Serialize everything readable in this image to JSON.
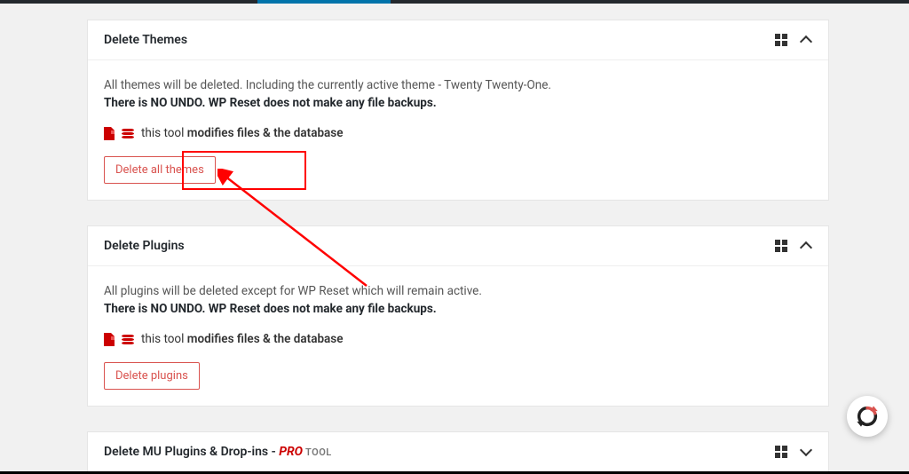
{
  "cards": {
    "themes": {
      "title": "Delete Themes",
      "desc": "All themes will be deleted. Including the currently active theme - Twenty Twenty-One.",
      "warn": "There is NO UNDO. WP Reset does not make any file backups.",
      "meta_prefix": "this tool ",
      "meta_bold": "modifies files & the database",
      "button": "Delete all themes"
    },
    "plugins": {
      "title": "Delete Plugins",
      "desc": "All plugins will be deleted except for WP Reset which will remain active.",
      "warn": "There is NO UNDO. WP Reset does not make any file backups.",
      "meta_prefix": "this tool ",
      "meta_bold": "modifies files & the database",
      "button": "Delete plugins"
    },
    "mu": {
      "title_prefix": "Delete MU Plugins & Drop-ins - ",
      "title_pro": "PRO",
      "title_tool": " TOOL"
    }
  }
}
